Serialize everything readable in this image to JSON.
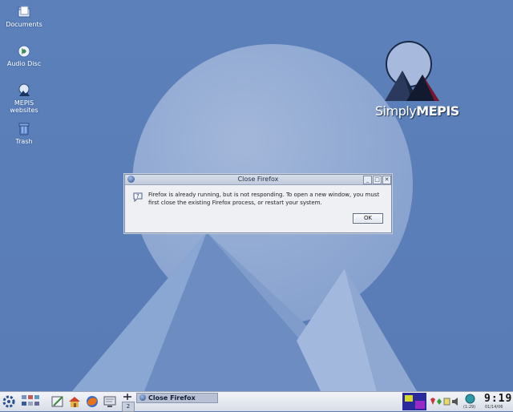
{
  "desktop": {
    "icons": [
      {
        "label": "Documents",
        "icon": "documents-folder-icon"
      },
      {
        "label": "Audio Disc",
        "icon": "audio-disc-icon"
      },
      {
        "label": "MEPIS\nwebsites",
        "icon": "mepis-websites-icon"
      },
      {
        "label": "Trash",
        "icon": "trash-icon"
      }
    ],
    "logo": {
      "simply": "Simply",
      "mepis": "MEPIS"
    }
  },
  "dialog": {
    "title": "Close Firefox",
    "message": "Firefox is already running, but is not responding. To open a new window, you must first close the existing Firefox process, or restart your system.",
    "ok_label": "OK",
    "titlebar_buttons": {
      "minimize": "_",
      "maximize": "□",
      "close": "✕"
    }
  },
  "taskbar": {
    "task_label": "Close Firefox",
    "pager_number": "2",
    "clock": "9:19",
    "date": "01/14/06",
    "timer": "(1:29)"
  },
  "colors": {
    "desktop_bg": "#5a7db8",
    "moon": "#8ea8d2",
    "taskbar_bg": "#e4e8ef"
  }
}
